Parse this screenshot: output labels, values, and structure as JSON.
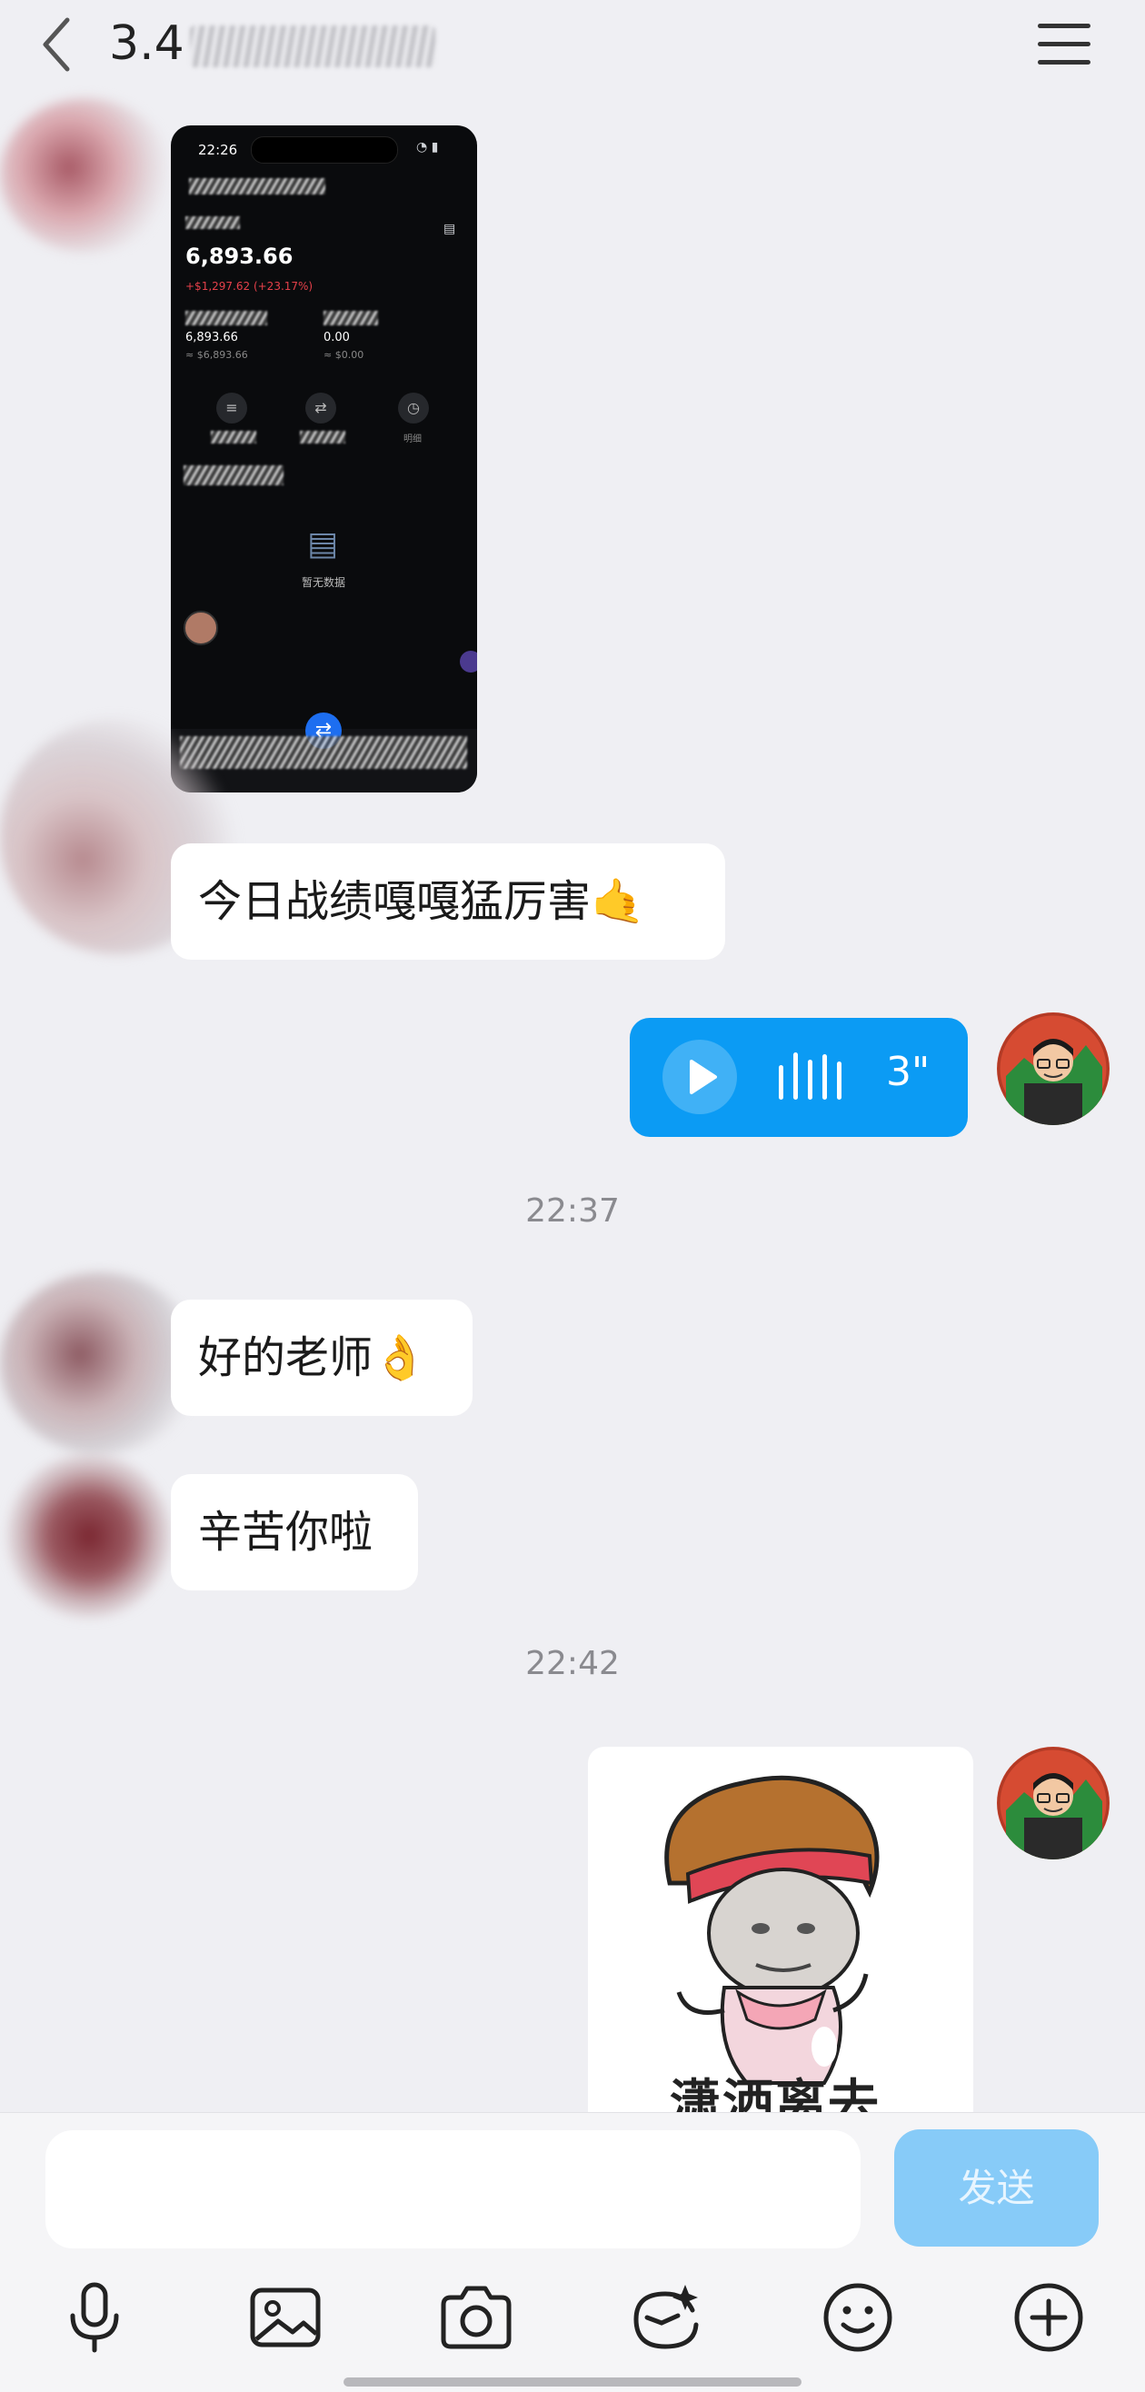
{
  "header": {
    "title": "3.4",
    "back_icon": "chevron-left-icon",
    "menu_icon": "hamburger-menu-icon"
  },
  "screenshot": {
    "time": "22:26",
    "balance": "6,893.66",
    "change": "+$1,297.62 (+23.17%)",
    "left_amount": "6,893.66",
    "left_sub": "≈ $6,893.66",
    "right_amount": "0.00",
    "right_sub": "≈ $0.00",
    "right_action_label": "明细",
    "empty_text": "暂无数据"
  },
  "messages": [
    {
      "text": "今日战绩嘎嘎猛厉害🤙"
    },
    {
      "voice_duration": "3\""
    },
    {
      "time": "22:37"
    },
    {
      "text": "好的老师👌"
    },
    {
      "text": "辛苦你啦"
    },
    {
      "time": "22:42"
    },
    {
      "sticker_caption": "潇洒离去"
    }
  ],
  "composer": {
    "send_label": "发送",
    "tools": [
      "microphone-icon",
      "image-icon",
      "camera-icon",
      "sticker-face-icon",
      "emoji-icon",
      "plus-circle-icon"
    ]
  },
  "colors": {
    "accent": "#0b9bf4",
    "send_disabled": "#87cbf8",
    "background": "#efeff3"
  }
}
